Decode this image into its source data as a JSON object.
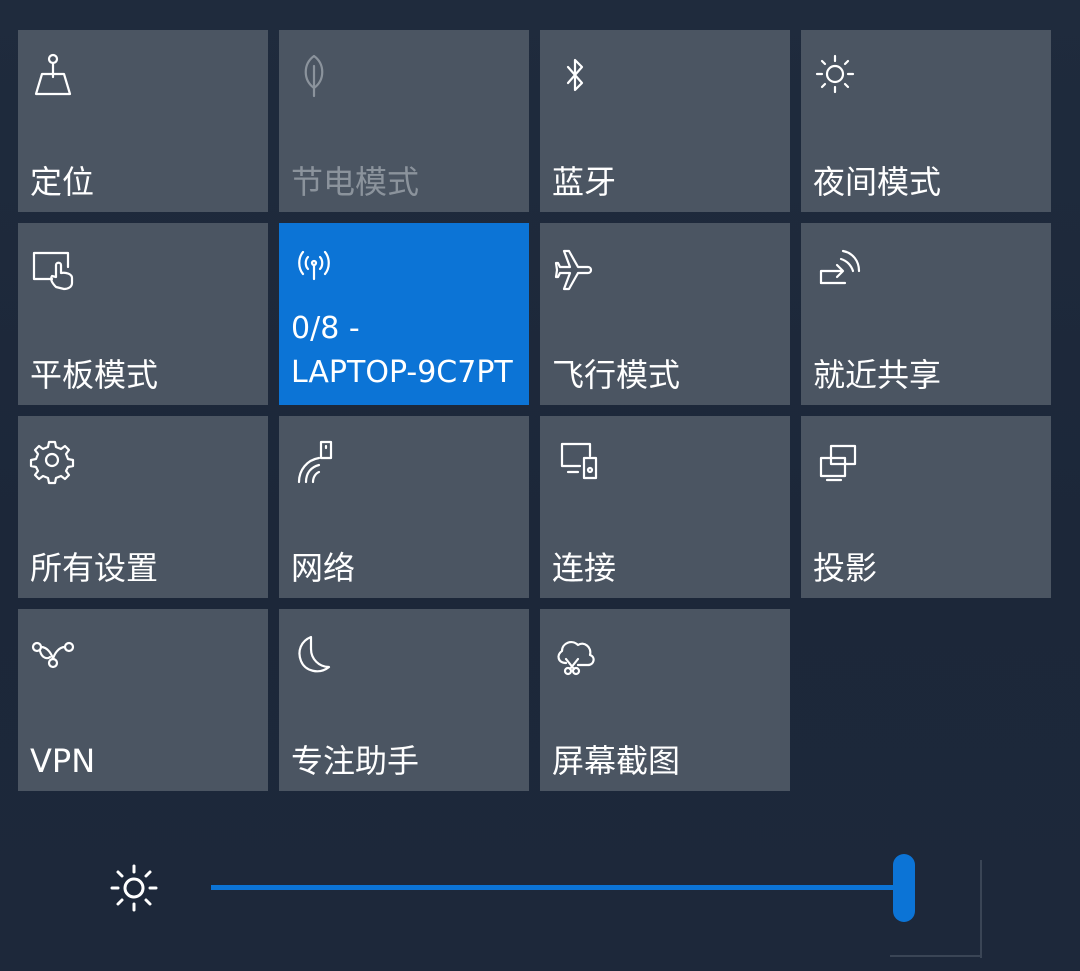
{
  "tiles": [
    {
      "label": "定位",
      "icon": "location-icon",
      "state": "normal"
    },
    {
      "label": "节电模式",
      "icon": "leaf-icon",
      "state": "disabled"
    },
    {
      "label": "蓝牙",
      "icon": "bluetooth-icon",
      "state": "normal"
    },
    {
      "label": "夜间模式",
      "icon": "night-light-icon",
      "state": "normal"
    },
    {
      "label": "平板模式",
      "icon": "tablet-mode-icon",
      "state": "normal"
    },
    {
      "label": "0/8 -\nLAPTOP-9C7PT",
      "icon": "mobile-hotspot-icon",
      "state": "active"
    },
    {
      "label": "飞行模式",
      "icon": "airplane-icon",
      "state": "normal"
    },
    {
      "label": "就近共享",
      "icon": "nearby-share-icon",
      "state": "normal"
    },
    {
      "label": "所有设置",
      "icon": "gear-icon",
      "state": "normal"
    },
    {
      "label": "网络",
      "icon": "network-icon",
      "state": "normal"
    },
    {
      "label": "连接",
      "icon": "connect-icon",
      "state": "normal"
    },
    {
      "label": "投影",
      "icon": "project-icon",
      "state": "normal"
    },
    {
      "label": "VPN",
      "icon": "vpn-icon",
      "state": "normal"
    },
    {
      "label": "专注助手",
      "icon": "moon-icon",
      "state": "normal"
    },
    {
      "label": "屏幕截图",
      "icon": "snip-icon",
      "state": "normal"
    }
  ],
  "brightness": {
    "icon": "brightness-icon",
    "value": 0.99
  },
  "colors": {
    "accent": "#0c74d6",
    "tile": "#4b5562",
    "background": "#1f2b3d"
  }
}
